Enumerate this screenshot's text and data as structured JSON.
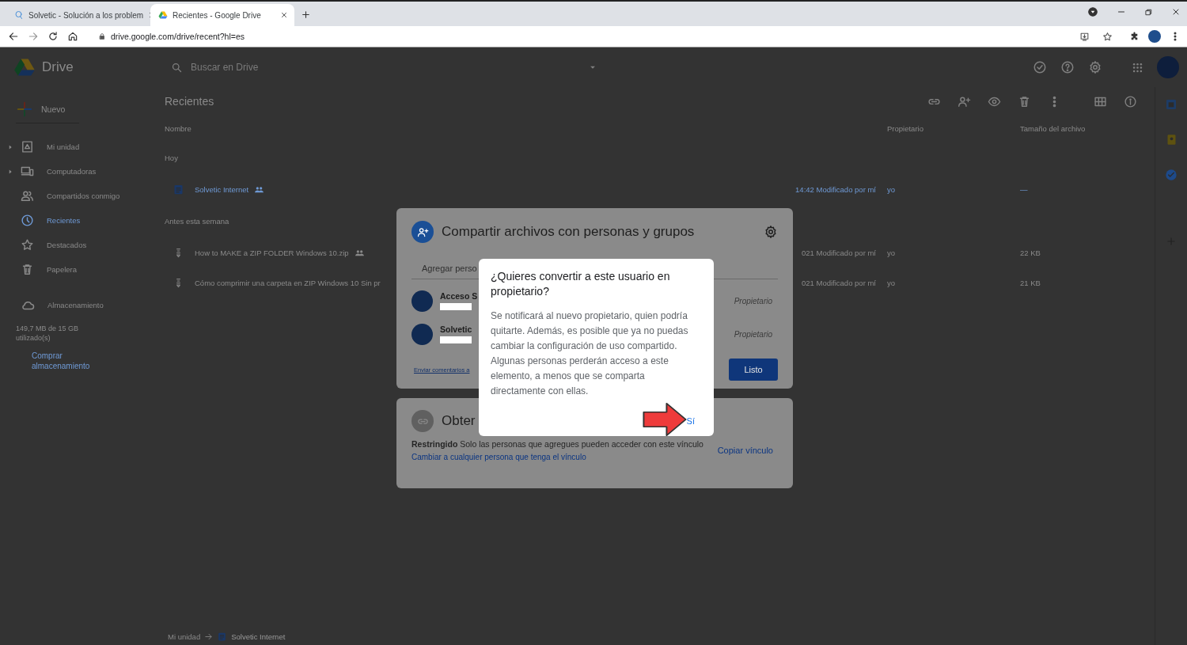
{
  "browser": {
    "tabs": [
      {
        "title": "Solvetic - Solución a los problem",
        "selected": false
      },
      {
        "title": "Recientes - Google Drive",
        "selected": true
      }
    ],
    "url": "drive.google.com/drive/recent?hl=es"
  },
  "drive": {
    "app_name": "Drive",
    "search": {
      "placeholder": "Buscar en Drive"
    },
    "new_button": "Nuevo",
    "nav": [
      {
        "label": "Mi unidad",
        "expandable": true,
        "selected": false
      },
      {
        "label": "Computadoras",
        "expandable": true,
        "selected": false
      },
      {
        "label": "Compartidos conmigo",
        "expandable": false,
        "selected": false
      },
      {
        "label": "Recientes",
        "expandable": false,
        "selected": true
      },
      {
        "label": "Destacados",
        "expandable": false,
        "selected": false
      },
      {
        "label": "Papelera",
        "expandable": false,
        "selected": false
      }
    ],
    "storage": {
      "label": "Almacenamiento",
      "usage": "149,7 MB de 15 GB utilizado(s)",
      "buy": "Comprar almacenamiento"
    },
    "heading": "Recientes",
    "columns": [
      "Nombre",
      "Propietario",
      "Tamaño del archivo"
    ],
    "sections": [
      {
        "title": "Hoy",
        "rows": [
          {
            "kind": "doc",
            "name": "Solvetic Internet",
            "shared": true,
            "selected": true,
            "modified": "14:42 Modificado por mí",
            "owner": "yo",
            "size": "—"
          }
        ]
      },
      {
        "title": "Antes esta semana",
        "rows": [
          {
            "kind": "zip",
            "name": "How to MAKE a ZIP FOLDER Windows 10.zip",
            "shared": true,
            "selected": false,
            "modified": "021 Modificado por mí",
            "owner": "yo",
            "size": "22 KB"
          },
          {
            "kind": "zip",
            "name": "Cómo comprimir una carpeta en ZIP Windows 10 Sin pr",
            "shared": false,
            "selected": false,
            "modified": "021 Modificado por mí",
            "owner": "yo",
            "size": "21 KB"
          }
        ]
      }
    ],
    "breadcrumb": [
      "Mi unidad",
      "Solvetic Internet"
    ]
  },
  "share_dialog": {
    "title": "Compartir archivos con personas y grupos",
    "add_placeholder": "Agregar perso",
    "people": [
      {
        "name": "Acceso S",
        "role": "Propietario"
      },
      {
        "name": "Solvetic",
        "role": "Propietario"
      }
    ],
    "feedback_link": "Enviar comentarios a",
    "done_button": "Listo"
  },
  "link_panel": {
    "title": "Obter",
    "description": "**Restringido** Solo las personas que agregues pueden acceder con este vínculo",
    "change_link": "Cambiar a cualquier persona que tenga el vínculo",
    "copy_link": "Copiar vínculo"
  },
  "confirm_dialog": {
    "title": "¿Quieres convertir a este usuario en propietario?",
    "body": "Se notificará al nuevo propietario, quien podría quitarte. Además, es posible que ya no puedas cambiar la configuración de uso compartido. Algunas personas perderán acceso a este elemento, a menos que se comparta directamente con ellas.",
    "confirm_button": "Sí"
  }
}
